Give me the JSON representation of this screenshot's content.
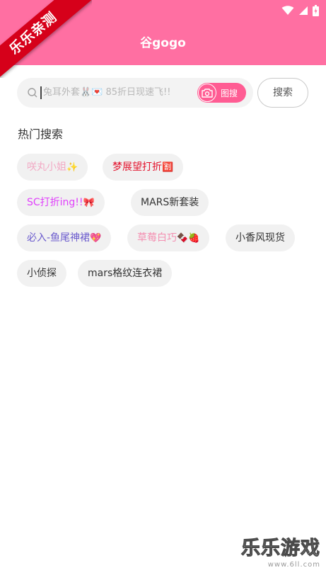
{
  "header": {
    "title": "谷gogo",
    "ribbon_text": "乐乐亲测",
    "background_color": "#ff6fa2"
  },
  "search": {
    "placeholder": "兔耳外套🐰💌 85折日现速飞!!",
    "image_search_label": "图搜",
    "button_label": "搜索"
  },
  "hot_search": {
    "title": "热门搜索",
    "tags": [
      {
        "text": "咲丸小姐",
        "emoji": "✨",
        "color": "#f2a9c4"
      },
      {
        "text": "梦展望打折",
        "emoji": "🈹",
        "color": "#e3122c"
      },
      {
        "text": "SC打折ing!!",
        "emoji": "🎀",
        "color": "#e040fb"
      },
      {
        "text": "MARS新套装",
        "emoji": "",
        "color": "#333333"
      },
      {
        "text": "必入-鱼尾神裙",
        "emoji": "💖",
        "color": "#6a5acd"
      },
      {
        "text": "草莓白巧",
        "emoji": "🍫🍓",
        "color": "#f48fb1"
      },
      {
        "text": "小香风现货",
        "emoji": "",
        "color": "#333333"
      },
      {
        "text": "小侦探",
        "emoji": "",
        "color": "#333333"
      },
      {
        "text": "mars格纹连衣裙",
        "emoji": "",
        "color": "#333333"
      }
    ]
  },
  "watermark": {
    "brand": "乐乐游戏",
    "url": "www.6ll.com"
  },
  "icons": [
    "wifi-icon",
    "signal-icon",
    "battery-icon",
    "menu-icon",
    "back-arrow-icon",
    "search-icon",
    "camera-icon"
  ]
}
